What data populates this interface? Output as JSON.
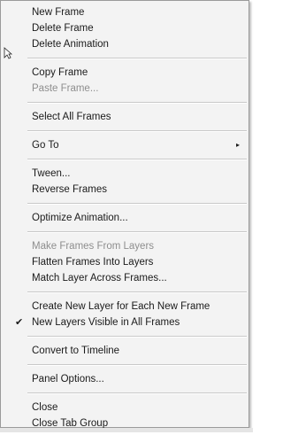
{
  "menu": {
    "groups": [
      {
        "items": [
          {
            "label": "New Frame",
            "enabled": true
          },
          {
            "label": "Delete Frame",
            "enabled": true
          },
          {
            "label": "Delete Animation",
            "enabled": true
          }
        ]
      },
      {
        "items": [
          {
            "label": "Copy Frame",
            "enabled": true
          },
          {
            "label": "Paste Frame...",
            "enabled": false
          }
        ]
      },
      {
        "items": [
          {
            "label": "Select All Frames",
            "enabled": true
          }
        ]
      },
      {
        "items": [
          {
            "label": "Go To",
            "enabled": true,
            "submenu_icon": "submenu-arrow-icon"
          }
        ]
      },
      {
        "items": [
          {
            "label": "Tween...",
            "enabled": true
          },
          {
            "label": "Reverse Frames",
            "enabled": true
          }
        ]
      },
      {
        "items": [
          {
            "label": "Optimize Animation...",
            "enabled": true
          }
        ]
      },
      {
        "items": [
          {
            "label": "Make Frames From Layers",
            "enabled": false
          },
          {
            "label": "Flatten Frames Into Layers",
            "enabled": true
          },
          {
            "label": "Match Layer Across Frames...",
            "enabled": true
          }
        ]
      },
      {
        "items": [
          {
            "label": "Create New Layer for Each New Frame",
            "enabled": true
          },
          {
            "label": "New Layers Visible in All Frames",
            "enabled": true,
            "checked": true
          }
        ]
      },
      {
        "items": [
          {
            "label": "Convert to Timeline",
            "enabled": true
          }
        ]
      },
      {
        "items": [
          {
            "label": "Panel Options...",
            "enabled": true
          }
        ]
      },
      {
        "items": [
          {
            "label": "Close",
            "enabled": true
          },
          {
            "label": "Close Tab Group",
            "enabled": true
          }
        ]
      }
    ]
  },
  "icons": {
    "check": "✔",
    "submenu": "▸"
  },
  "colors": {
    "background": "#f3f3f3",
    "text": "#1a1a1a",
    "disabled_text": "#8e8e8e",
    "separator": "#c9c9c9"
  }
}
